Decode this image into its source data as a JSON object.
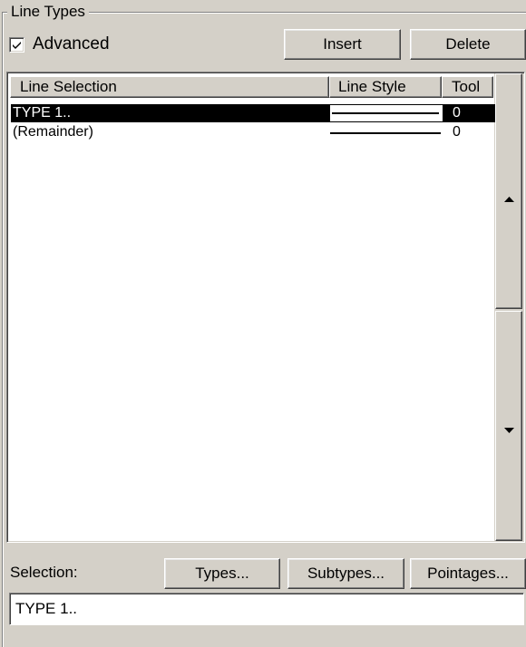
{
  "group": {
    "title": "Line Types"
  },
  "advanced": {
    "label": "Advanced",
    "checked": true
  },
  "toolbar": {
    "insert_label": "Insert",
    "delete_label": "Delete"
  },
  "list": {
    "columns": [
      "Line Selection",
      "Line Style",
      "Tool"
    ],
    "rows": [
      {
        "selection": "TYPE 1..",
        "tool": "0",
        "selected": true
      },
      {
        "selection": "(Remainder)",
        "tool": "0",
        "selected": false
      }
    ]
  },
  "scrollbar": {
    "up_icon": "up-arrow-icon",
    "down_icon": "down-arrow-icon"
  },
  "bottom": {
    "selection_label": "Selection:",
    "types_label": "Types...",
    "subtypes_label": "Subtypes...",
    "pointages_label": "Pointages...",
    "selection_value": "TYPE 1.."
  },
  "colors": {
    "face": "#d4d0c8",
    "highlight": "#000000",
    "window": "#ffffff"
  }
}
